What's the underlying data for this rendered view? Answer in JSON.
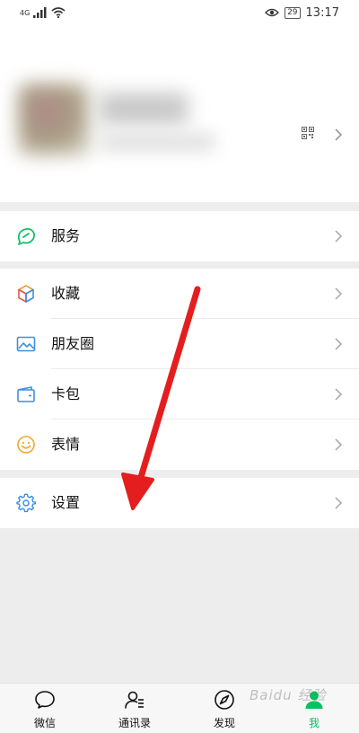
{
  "status_bar": {
    "network": "4G",
    "time": "13:17",
    "battery": "29"
  },
  "profile": {
    "avatar_blurred": true
  },
  "menu": {
    "services": {
      "label": "服务",
      "icon": "services-icon"
    },
    "group2": [
      {
        "label": "收藏",
        "icon": "favorites-cube-icon"
      },
      {
        "label": "朋友圈",
        "icon": "moments-image-icon"
      },
      {
        "label": "卡包",
        "icon": "card-wallet-icon"
      },
      {
        "label": "表情",
        "icon": "sticker-smile-icon"
      }
    ],
    "settings": {
      "label": "设置",
      "icon": "gear-icon"
    }
  },
  "tabbar": {
    "tabs": [
      {
        "label": "微信",
        "icon": "chat-bubble-icon",
        "active": false
      },
      {
        "label": "通讯录",
        "icon": "contacts-icon",
        "active": false
      },
      {
        "label": "发现",
        "icon": "compass-icon",
        "active": false
      },
      {
        "label": "我",
        "icon": "me-person-icon",
        "active": true
      }
    ]
  },
  "watermark": "Baidu 经验",
  "colors": {
    "accent_green": "#07c160",
    "background": "#ededed",
    "annotation_arrow": "#e41e1e"
  }
}
